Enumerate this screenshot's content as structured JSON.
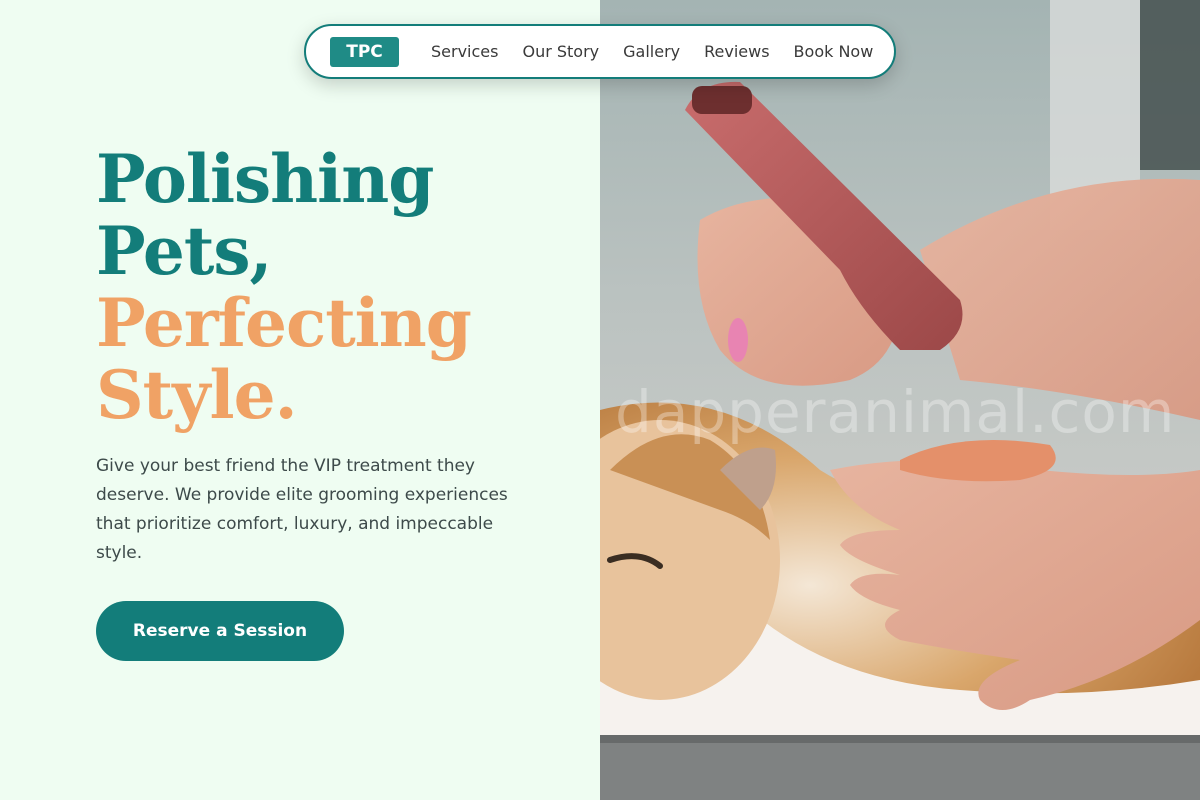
{
  "nav": {
    "logo": "TPC",
    "links": [
      "Services",
      "Our Story",
      "Gallery",
      "Reviews",
      "Book Now"
    ]
  },
  "hero": {
    "headline_line1": "Polishing",
    "headline_line2": "Pets,",
    "headline_line3": "Perfecting",
    "headline_line4": "Style.",
    "lede": "Give your best friend the VIP treatment they deserve. We provide elite grooming experiences that prioritize comfort, luxury, and impeccable style.",
    "cta_label": "Reserve a Session"
  },
  "photo": {
    "watermark": "dapperanimal.com",
    "subject": "groomer-trimming-persian-cat"
  },
  "colors": {
    "teal": "#137d7a",
    "orange": "#f0a265",
    "background": "#effdf2",
    "logo_bg": "#1f8b86"
  }
}
